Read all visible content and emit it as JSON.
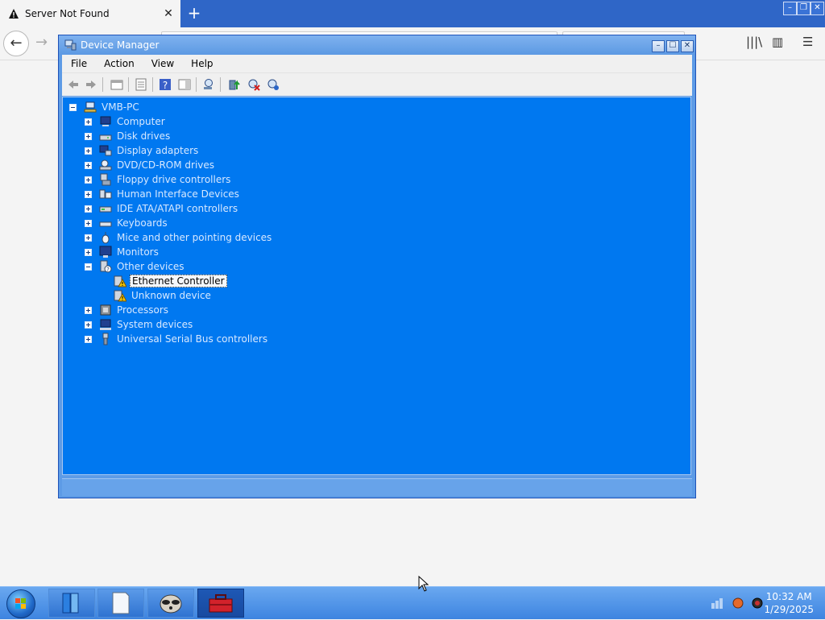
{
  "browser": {
    "tab_title": "Server Not Found",
    "tab_close": "✕",
    "new_tab": "+",
    "back": "←",
    "forward": "→",
    "library_icon": "|||\\",
    "sidebar_icon": "▥",
    "menu_icon": "☰",
    "window_controls": [
      "–",
      "❐",
      "✕"
    ]
  },
  "device_manager": {
    "title": "Device Manager",
    "title_buttons": [
      "–",
      "☐",
      "✕"
    ],
    "menu": [
      "File",
      "Action",
      "View",
      "Help"
    ],
    "tree": {
      "root": "VMB-PC",
      "categories": [
        {
          "label": "Computer",
          "expanded": false,
          "icon": "computer-icon"
        },
        {
          "label": "Disk drives",
          "expanded": false,
          "icon": "disk-drive-icon"
        },
        {
          "label": "Display adapters",
          "expanded": false,
          "icon": "display-adapter-icon"
        },
        {
          "label": "DVD/CD-ROM drives",
          "expanded": false,
          "icon": "dvd-drive-icon"
        },
        {
          "label": "Floppy drive controllers",
          "expanded": false,
          "icon": "floppy-controller-icon"
        },
        {
          "label": "Human Interface Devices",
          "expanded": false,
          "icon": "hid-icon"
        },
        {
          "label": "IDE ATA/ATAPI controllers",
          "expanded": false,
          "icon": "ide-controller-icon"
        },
        {
          "label": "Keyboards",
          "expanded": false,
          "icon": "keyboard-icon"
        },
        {
          "label": "Mice and other pointing devices",
          "expanded": false,
          "icon": "mouse-icon"
        },
        {
          "label": "Monitors",
          "expanded": false,
          "icon": "monitor-icon"
        },
        {
          "label": "Other devices",
          "expanded": true,
          "icon": "other-devices-icon",
          "children": [
            {
              "label": "Ethernet Controller",
              "selected": true,
              "icon": "warning-device-icon"
            },
            {
              "label": "Unknown device",
              "selected": false,
              "icon": "warning-device-icon"
            }
          ]
        },
        {
          "label": "Processors",
          "expanded": false,
          "icon": "processor-icon"
        },
        {
          "label": "System devices",
          "expanded": false,
          "icon": "system-devices-icon"
        },
        {
          "label": "Universal Serial Bus controllers",
          "expanded": false,
          "icon": "usb-icon"
        }
      ]
    }
  },
  "taskbar": {
    "time": "10:32 AM",
    "date": "1/29/2025",
    "buttons": [
      "file-explorer-icon",
      "document-icon",
      "raccoon-app-icon",
      "toolbox-icon"
    ]
  },
  "colors": {
    "tree_bg": "#0078f0",
    "window_frame": "#5d9be6",
    "tabstrip": "#2f66c7"
  }
}
